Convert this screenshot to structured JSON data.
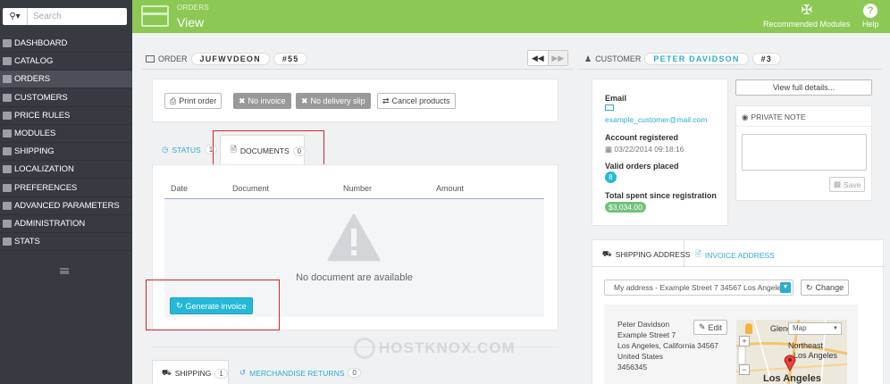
{
  "sidebar": {
    "search_placeholder": "Search",
    "items": [
      {
        "label": "Dashboard",
        "icon": "dashboard-icon"
      },
      {
        "label": "Catalog",
        "icon": "catalog-icon"
      },
      {
        "label": "Orders",
        "icon": "orders-icon",
        "active": true
      },
      {
        "label": "Customers",
        "icon": "customers-icon"
      },
      {
        "label": "Price Rules",
        "icon": "price-rules-icon"
      },
      {
        "label": "Modules",
        "icon": "modules-icon"
      },
      {
        "label": "Shipping",
        "icon": "shipping-icon"
      },
      {
        "label": "Localization",
        "icon": "localization-icon"
      },
      {
        "label": "Preferences",
        "icon": "preferences-icon"
      },
      {
        "label": "Advanced Parameters",
        "icon": "advanced-parameters-icon"
      },
      {
        "label": "Administration",
        "icon": "administration-icon"
      },
      {
        "label": "Stats",
        "icon": "stats-icon"
      }
    ]
  },
  "header": {
    "breadcrumb": "ORDERS",
    "title": "View",
    "modules_label": "Recommended Modules",
    "help_label": "Help"
  },
  "order": {
    "label": "ORDER",
    "reference": "JUFWVDEON",
    "number": "#55",
    "actions": {
      "print": "Print order",
      "no_invoice": "No invoice",
      "no_delivery": "No delivery slip",
      "cancel": "Cancel products"
    },
    "tabs": {
      "status": "STATUS",
      "status_count": "1",
      "documents": "DOCUMENTS",
      "documents_count": "0"
    },
    "table_headers": [
      "Date",
      "Document",
      "Number",
      "Amount"
    ],
    "empty_message": "No document are available",
    "generate_button": "Generate invoice",
    "bottom_tabs": {
      "shipping": "SHIPPING",
      "shipping_count": "1",
      "returns": "MERCHANDISE RETURNS",
      "returns_count": "0"
    }
  },
  "customer": {
    "label": "CUSTOMER",
    "name": "PETER DAVIDSON",
    "number": "#3",
    "email_label": "Email",
    "email": "example_customer@mail.com",
    "registered_label": "Account registered",
    "registered": "03/22/2014 09:18:16",
    "valid_orders_label": "Valid orders placed",
    "valid_orders": "8",
    "total_spent_label": "Total spent since registration",
    "total_spent": "$3,034.00",
    "view_details": "View full details...",
    "private_note": "PRIVATE NOTE",
    "save": "Save"
  },
  "address": {
    "tab_shipping": "SHIPPING ADDRESS",
    "tab_invoice": "INVOICE ADDRESS",
    "select_value": "My address - Example Street 7 34567 Los Angeles",
    "change": "Change",
    "edit": "Edit",
    "lines": [
      "Peter Davidson",
      "Example Street 7",
      "Los Angeles, California 34567",
      "United States",
      "3456345"
    ],
    "map_type": "Map",
    "map_labels": [
      "Glendale",
      "Northeast",
      "Los Angeles",
      "Los Angeles"
    ]
  },
  "watermark": "HOSTKNOX.COM",
  "colors": {
    "header_green": "#8bc954",
    "sidebar": "#363a41",
    "accent_blue": "#2eacce",
    "highlight_red": "#d6242c"
  }
}
